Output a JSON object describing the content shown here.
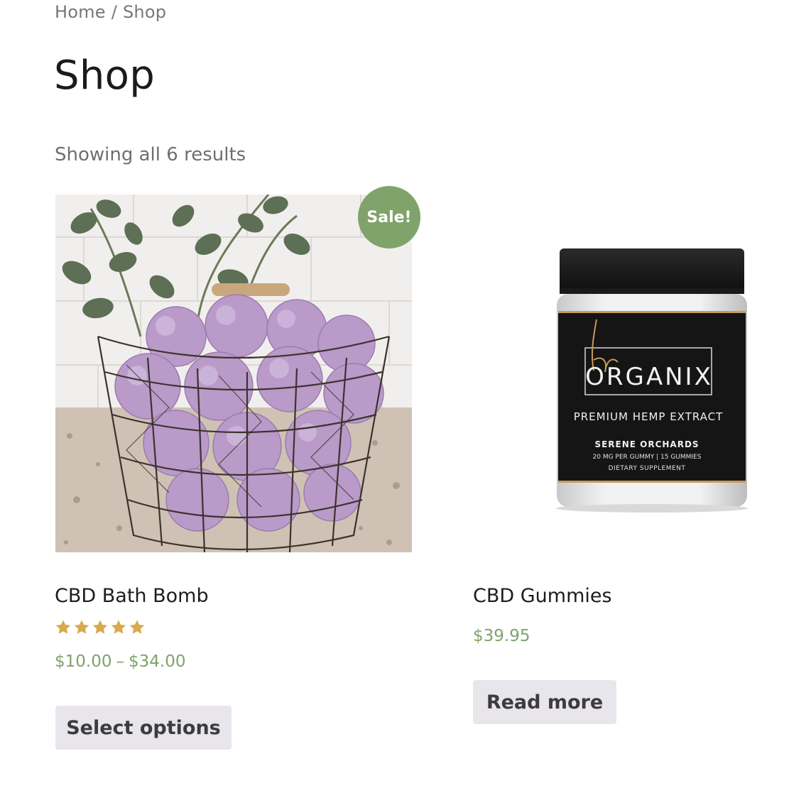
{
  "breadcrumb": {
    "home": "Home",
    "separator": "/",
    "current": "Shop"
  },
  "page": {
    "title": "Shop",
    "result_count": "Showing all 6 results"
  },
  "products": [
    {
      "name": "CBD Bath Bomb",
      "badge": "Sale!",
      "rating": 5,
      "rating_max": 5,
      "price_low": "$10.00",
      "price_dash": "–",
      "price_high": "$34.00",
      "button": "Select options"
    },
    {
      "name": "CBD Gummies",
      "price": "$39.95",
      "button": "Read more",
      "label": {
        "brand": "ORGANIX",
        "line1": "PREMIUM HEMP EXTRACT",
        "line2": "SERENE ORCHARDS",
        "line3": "20 MG PER GUMMY | 15 GUMMIES",
        "line4": "DIETARY SUPPLEMENT"
      }
    }
  ],
  "colors": {
    "accent": "#7fa36a",
    "star": "#d9a94e",
    "button_bg": "#e8e6ea"
  }
}
